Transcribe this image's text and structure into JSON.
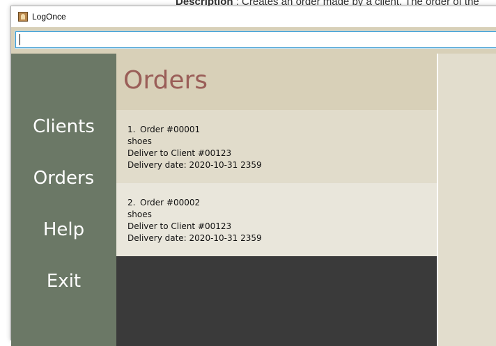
{
  "background_doc": {
    "label": "Description",
    "text": ": Creates an order made by a client. The order of the"
  },
  "window": {
    "title": "LogOnce",
    "icon": "app-icon"
  },
  "command_box": {
    "value": "",
    "placeholder": ""
  },
  "sidebar": {
    "items": [
      {
        "label": "Clients"
      },
      {
        "label": "Orders"
      },
      {
        "label": "Help"
      },
      {
        "label": "Exit"
      }
    ]
  },
  "main": {
    "title": "Orders",
    "orders": [
      {
        "index": "1.",
        "order": "Order #00001",
        "item": "shoes",
        "deliver": "Deliver to Client #00123",
        "date": "Delivery date: 2020-10-31 2359"
      },
      {
        "index": "2.",
        "order": "Order #00002",
        "item": "shoes",
        "deliver": "Deliver to Client #00123",
        "date": "Delivery date: 2020-10-31 2359"
      }
    ]
  },
  "colors": {
    "sidebar": "#6b7866",
    "header": "#d8d0b8",
    "title": "#9a5e58",
    "list_bg": "#3a3a3a"
  }
}
